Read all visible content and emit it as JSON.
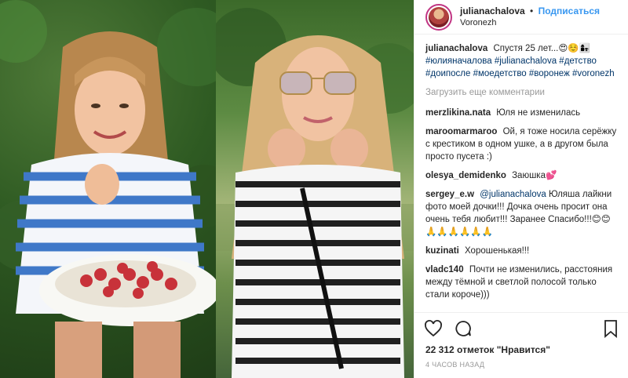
{
  "header": {
    "username": "julianachalova",
    "separator": "•",
    "follow_label": "Подписаться",
    "location": "Voronezh"
  },
  "caption": {
    "username": "julianachalova",
    "text": "Спустя 25 лет...😍☺️👩‍👧",
    "hashtags": "#юлияначалова #julianachalova #детство #доипосле #моедетство #воронеж #voronezh"
  },
  "load_more_label": "Загрузить еще комментарии",
  "comments": [
    {
      "user": "merzlikina.nata",
      "text": "Юля не изменилась"
    },
    {
      "user": "maroomarmaroo",
      "text": "Ой, я тоже носила серёжку с крестиком в одном ушке, а в другом была просто пусета :)"
    },
    {
      "user": "olesya_demidenko",
      "text": "Заюшка💕"
    },
    {
      "user": "sergey_e.w",
      "mention": "@julianachalova",
      "text": "Юляша лайкни фото моей дочки!!! Дочка очень просит она очень тебя любит!!! Заранее Спасибо!!!😊😊🙏🙏🙏🙏🙏🙏"
    },
    {
      "user": "kuzinati",
      "text": "Хорошенькая!!!"
    },
    {
      "user": "vladc140",
      "text": "Почти не изменились, расстояния между тёмной и светлой полосой только стали короче)))"
    }
  ],
  "likes_label": "22 312 отметок \"Нравится\"",
  "time_label": "4 часов назад",
  "icons": {
    "like": "heart-icon",
    "comment": "comment-icon",
    "save": "bookmark-icon"
  },
  "colors": {
    "link_blue": "#3897f0",
    "hashtag": "#003569",
    "muted": "#999999",
    "story_ring": "#c13584"
  }
}
